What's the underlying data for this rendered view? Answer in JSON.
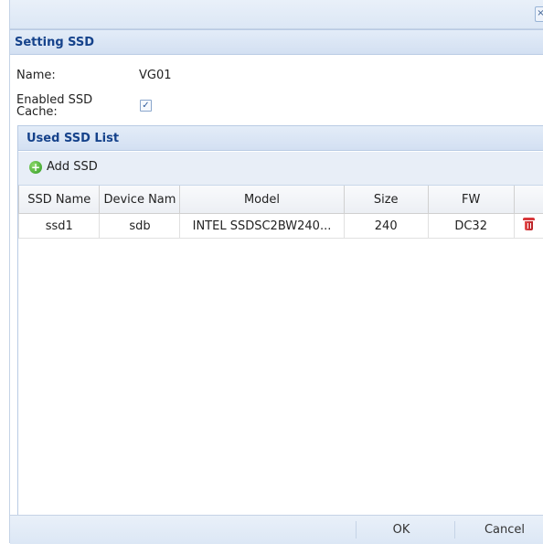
{
  "dialog": {
    "close_glyph": "×"
  },
  "setting_section": {
    "title": "Setting SSD",
    "name_label": "Name:",
    "name_value": "VG01",
    "cache_label_line1": "Enabled SSD",
    "cache_label_line2": "Cache:",
    "cache_checked": true,
    "check_glyph": "✓"
  },
  "ssd_list": {
    "title": "Used SSD List",
    "add_button": "Add SSD",
    "add_icon": "plus-circle-icon",
    "columns": [
      "SSD Name",
      "Device Nam",
      "Model",
      "Size",
      "FW",
      ""
    ],
    "rows": [
      {
        "ssd_name": "ssd1",
        "device_name": "sdb",
        "model": "INTEL SSDSC2BW240...",
        "size": "240",
        "fw": "DC32",
        "action_icon": "trash-icon"
      }
    ]
  },
  "footer": {
    "ok_label": "OK",
    "cancel_label": "Cancel"
  },
  "colors": {
    "header_text": "#15428b",
    "header_bg": "#dce7f5",
    "delete_icon": "#d8373a",
    "add_icon": "#2f9b25"
  }
}
